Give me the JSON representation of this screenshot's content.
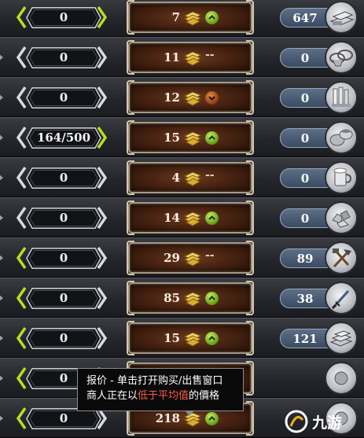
{
  "rows": [
    {
      "quantity": "0",
      "price": "7",
      "price_trend": "up",
      "stock": "647",
      "item_icon": "ingot-stack-icon",
      "left_arrow_active": true,
      "right_arrow_active": true
    },
    {
      "quantity": "0",
      "price": "11",
      "price_trend": "none",
      "price_trend_text": "--",
      "stock": "0",
      "item_icon": "baskets-icon",
      "left_arrow_active": false,
      "right_arrow_active": false
    },
    {
      "quantity": "0",
      "price": "12",
      "price_trend": "down",
      "stock": "0",
      "item_icon": "silver-bars-icon",
      "left_arrow_active": false,
      "right_arrow_active": false
    },
    {
      "quantity": "164/500",
      "price": "15",
      "price_trend": "up",
      "stock": "0",
      "item_icon": "pots-icon",
      "left_arrow_active": false,
      "right_arrow_active": true
    },
    {
      "quantity": "0",
      "price": "4",
      "price_trend": "none",
      "price_trend_text": "--",
      "stock": "0",
      "item_icon": "beer-mug-icon",
      "left_arrow_active": false,
      "right_arrow_active": false
    },
    {
      "quantity": "0",
      "price": "14",
      "price_trend": "up",
      "stock": "0",
      "item_icon": "ore-icon",
      "left_arrow_active": false,
      "right_arrow_active": false
    },
    {
      "quantity": "0",
      "price": "29",
      "price_trend": "none",
      "price_trend_text": "--",
      "stock": "89",
      "item_icon": "tools-icon",
      "left_arrow_active": true,
      "right_arrow_active": false
    },
    {
      "quantity": "0",
      "price": "85",
      "price_trend": "up",
      "stock": "38",
      "item_icon": "dagger-icon",
      "left_arrow_active": true,
      "right_arrow_active": false
    },
    {
      "quantity": "0",
      "price": "15",
      "price_trend": "up",
      "stock": "121",
      "item_icon": "iron-ingots-icon",
      "left_arrow_active": true,
      "right_arrow_active": false
    },
    {
      "quantity": "0",
      "price": "",
      "price_trend": "none",
      "stock": "",
      "item_icon": "item-icon",
      "left_arrow_active": true,
      "right_arrow_active": false
    },
    {
      "quantity": "0",
      "price": "218",
      "price_trend": "up",
      "stock": "",
      "item_icon": "item-icon",
      "left_arrow_active": true,
      "right_arrow_active": false
    }
  ],
  "tooltip": {
    "line1": "报价 - 单击打开购买/出售窗口",
    "line2_before": "商人正在以",
    "line2_highlight": "低于平均值",
    "line2_after": "的價格"
  },
  "watermark": {
    "text": "九游"
  },
  "colors": {
    "accent_green": "#9ad21f",
    "highlight_red": "#ff5a45",
    "stock_badge": "#4a5d75",
    "price_box": "#4a2412"
  }
}
